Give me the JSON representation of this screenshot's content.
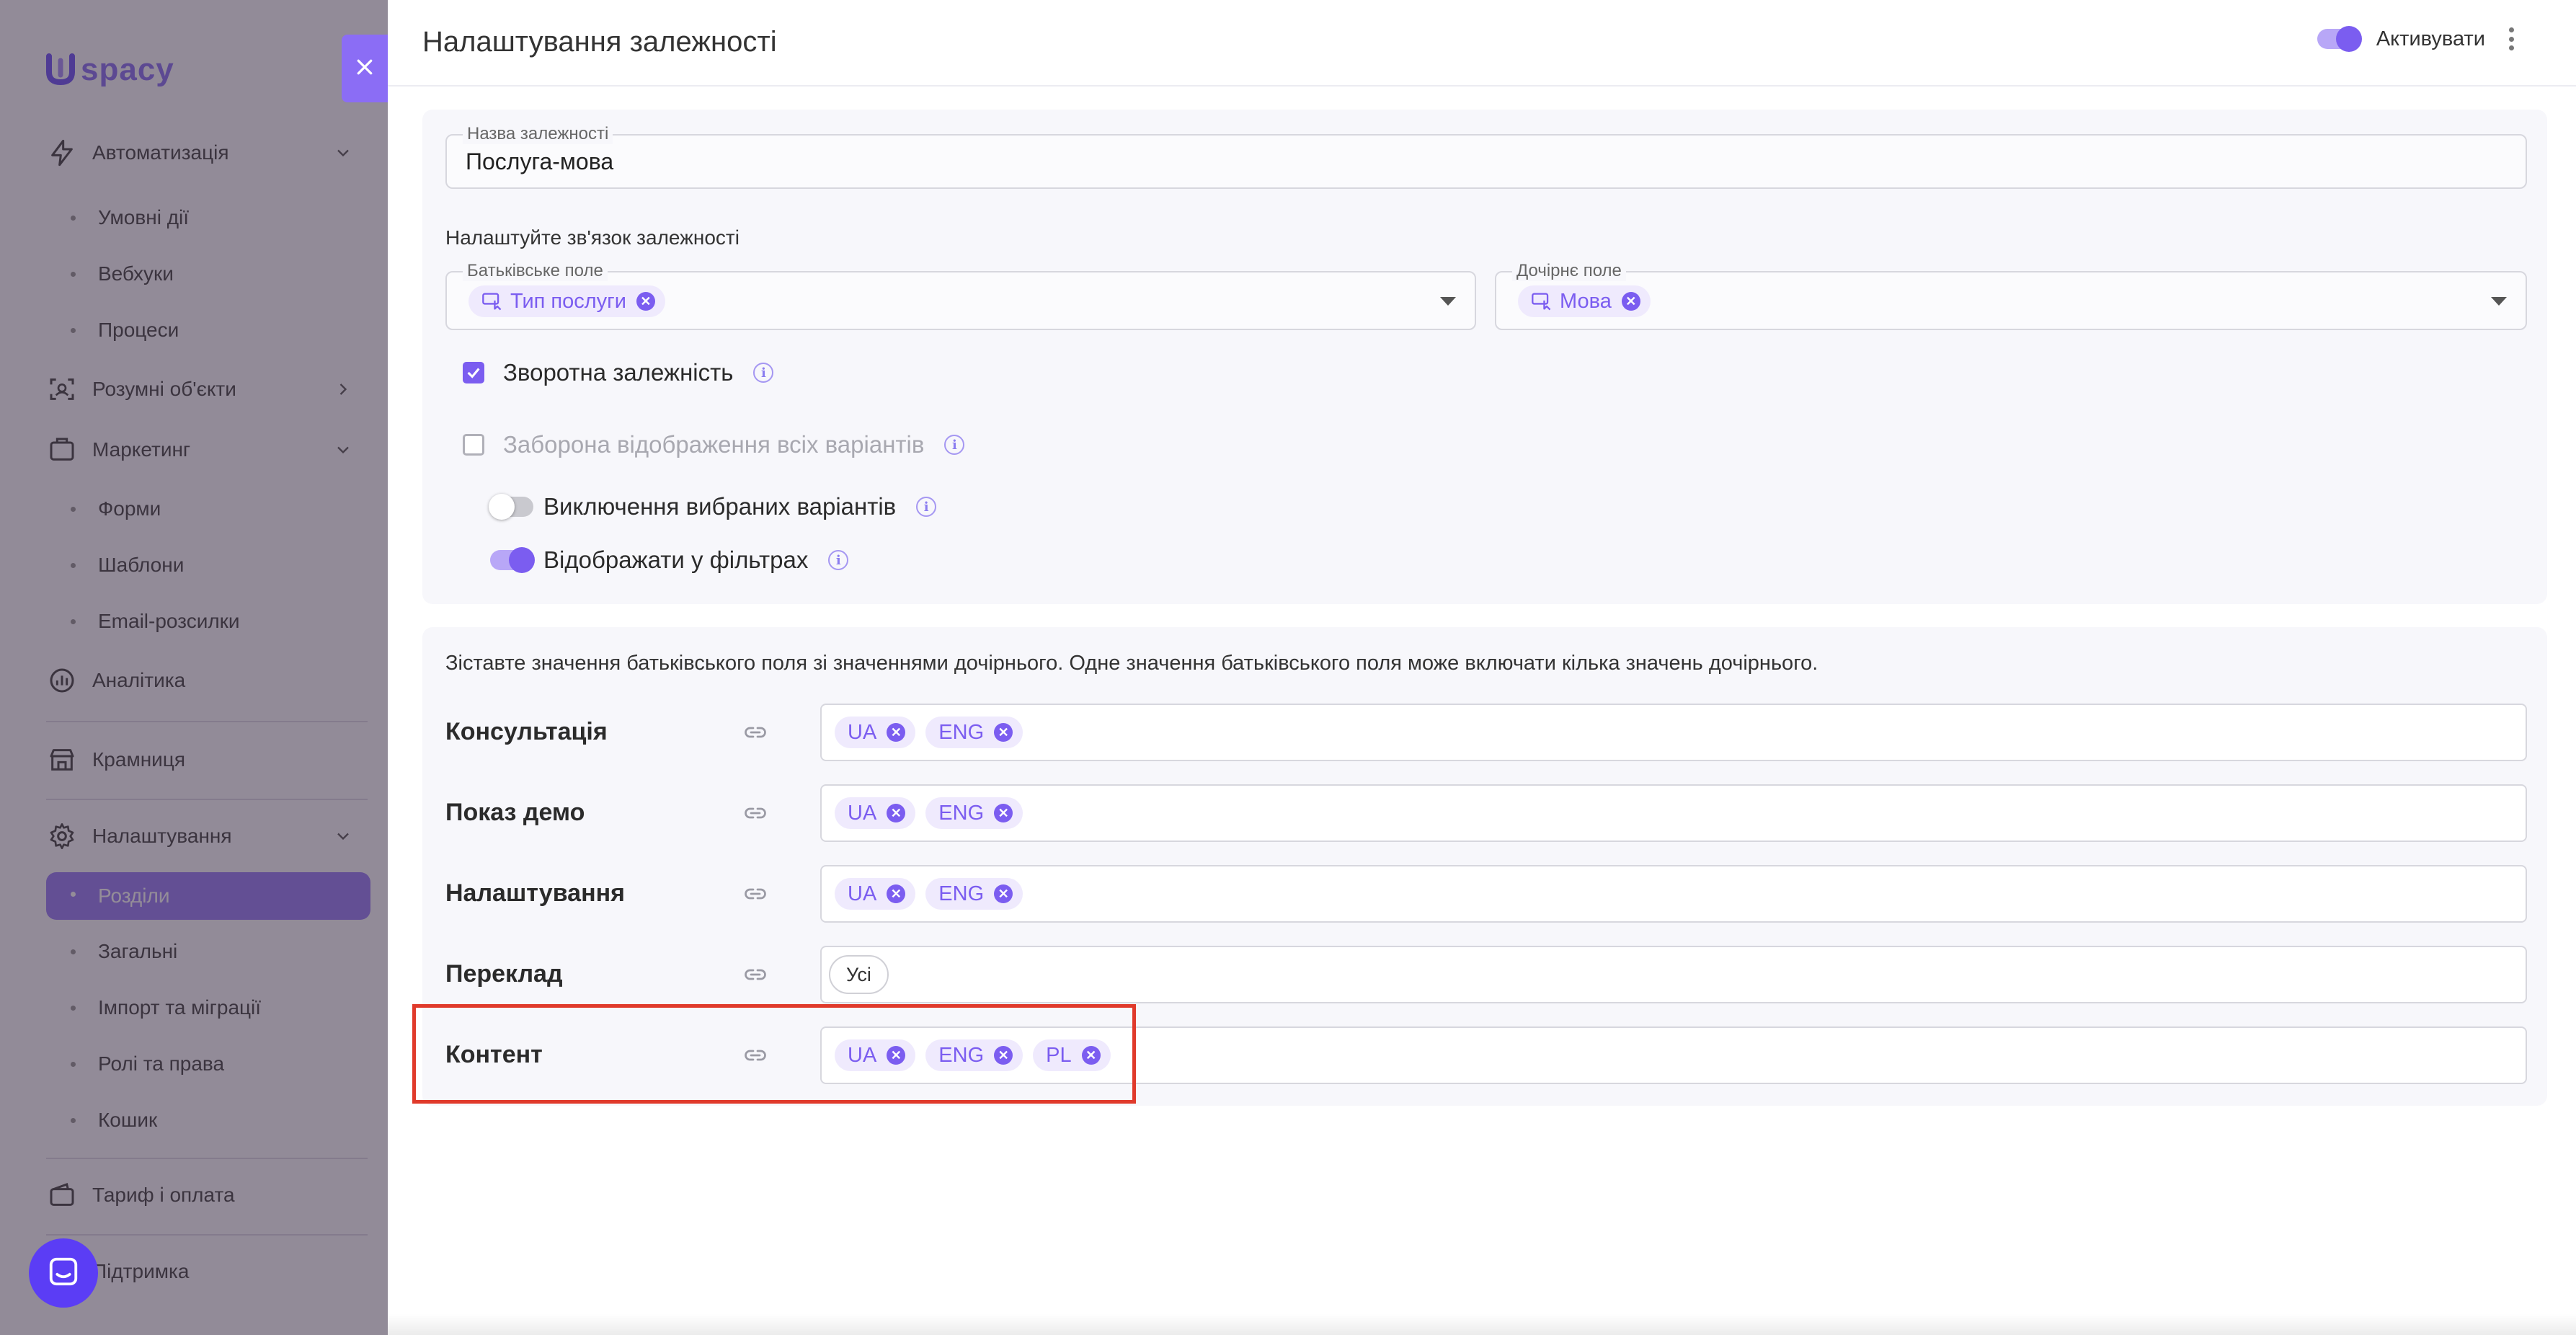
{
  "sidebar": {
    "logo_text": "spacy",
    "items": [
      {
        "type": "section",
        "label": "Автоматизація",
        "icon": "lightning-icon",
        "chevron": "down"
      },
      {
        "type": "sub",
        "label": "Умовні дії"
      },
      {
        "type": "sub",
        "label": "Вебхуки"
      },
      {
        "type": "sub",
        "label": "Процеси"
      },
      {
        "type": "section",
        "label": "Розумні об'єкти",
        "icon": "smart-objects-icon",
        "chevron": "right"
      },
      {
        "type": "section",
        "label": "Маркетинг",
        "icon": "marketing-icon",
        "chevron": "down"
      },
      {
        "type": "sub",
        "label": "Форми"
      },
      {
        "type": "sub",
        "label": "Шаблони"
      },
      {
        "type": "sub",
        "label": "Email-розсилки"
      },
      {
        "type": "section",
        "label": "Аналітика",
        "icon": "analytics-icon"
      },
      {
        "type": "section",
        "label": "Крамниця",
        "icon": "store-icon"
      },
      {
        "type": "section",
        "label": "Налаштування",
        "icon": "gear-icon",
        "chevron": "down"
      },
      {
        "type": "sub",
        "label": "Розділи",
        "active": true
      },
      {
        "type": "sub",
        "label": "Загальні"
      },
      {
        "type": "sub",
        "label": "Імпорт та міграції"
      },
      {
        "type": "sub",
        "label": "Ролі та права"
      },
      {
        "type": "sub",
        "label": "Кошик"
      },
      {
        "type": "section",
        "label": "Тариф і оплата",
        "icon": "wallet-icon"
      },
      {
        "type": "section",
        "label": "Підтримка",
        "icon": "support-icon"
      }
    ]
  },
  "header": {
    "title": "Налаштування залежності",
    "activate_label": "Активувати",
    "activate_on": true
  },
  "form": {
    "name_label": "Назва залежності",
    "name_value": "Послуга-мова",
    "relation_heading": "Налаштуйте зв'язок залежності",
    "parent_label": "Батьківське поле",
    "parent_value": "Тип послуги",
    "child_label": "Дочірнє поле",
    "child_value": "Мова",
    "options": {
      "reverse": {
        "label": "Зворотна залежність",
        "checked": true
      },
      "forbid_all": {
        "label": "Заборона відображення всіх варіантів",
        "checked": false,
        "disabled": true
      },
      "exclude_selected": {
        "label": "Виключення вибраних варіантів",
        "on": false
      },
      "show_in_filters": {
        "label": "Відображати у фільтрах",
        "on": true
      }
    }
  },
  "mapping": {
    "description": "Зіставте значення батьківського поля зі значеннями дочірнього. Одне значення батьківського поля може включати кілька значень дочірнього.",
    "rows": [
      {
        "parent": "Консультація",
        "children": [
          "UA",
          "ENG"
        ]
      },
      {
        "parent": "Показ демо",
        "children": [
          "UA",
          "ENG"
        ]
      },
      {
        "parent": "Налаштування",
        "children": [
          "UA",
          "ENG"
        ]
      },
      {
        "parent": "Переклад",
        "all_label": "Усі"
      },
      {
        "parent": "Контент",
        "children": [
          "UA",
          "ENG",
          "PL"
        ]
      }
    ]
  },
  "colors": {
    "accent": "#7b5df0",
    "chip_bg": "#efeafd",
    "highlight": "#e03a2b"
  }
}
